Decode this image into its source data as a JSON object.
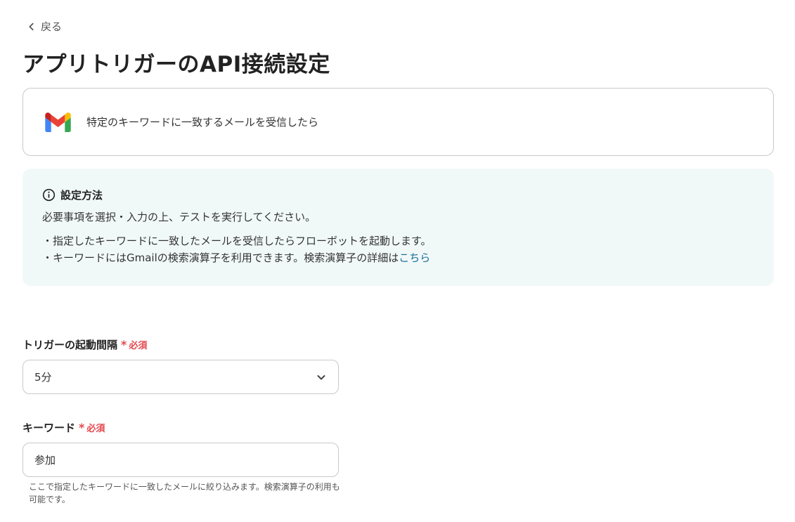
{
  "header": {
    "back_label": "戻る",
    "title": "アプリトリガーのAPI接続設定"
  },
  "trigger": {
    "icon": "gmail-icon",
    "text": "特定のキーワードに一致するメールを受信したら"
  },
  "info": {
    "heading": "設定方法",
    "line1": "必要事項を選択・入力の上、テストを実行してください。",
    "line2": "・指定したキーワードに一致したメールを受信したらフローボットを起動します。",
    "line3_text": "・キーワードにはGmailの検索演算子を利用できます。検索演算子の詳細は",
    "line3_link": "こちら"
  },
  "interval_field": {
    "label": "トリガーの起動間隔",
    "required_star": "*",
    "required_text": "必須",
    "value": "5分"
  },
  "keyword_field": {
    "label": "キーワード",
    "required_star": "*",
    "required_text": "必須",
    "value": "参加",
    "help": "ここで指定したキーワードに一致したメールに絞り込みます。検索演算子の利用も可能です。"
  },
  "colors": {
    "required": "#e5484d",
    "link": "#1b6f9c",
    "info_bg": "#f1f9f8",
    "border": "#c9c9c9"
  }
}
